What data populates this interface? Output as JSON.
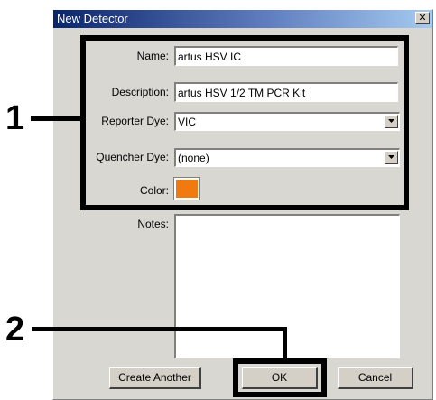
{
  "window": {
    "title": "New Detector",
    "close_glyph": "✕"
  },
  "form": {
    "name_label": "Name:",
    "name_value": "artus HSV IC",
    "description_label": "Description:",
    "description_value": "artus HSV 1/2 TM PCR Kit",
    "reporter_dye_label": "Reporter Dye:",
    "reporter_dye_value": "VIC",
    "quencher_dye_label": "Quencher Dye:",
    "quencher_dye_value": "(none)",
    "color_label": "Color:",
    "color_value": "#f07a10",
    "notes_label": "Notes:",
    "notes_value": ""
  },
  "buttons": {
    "create_another": "Create Another",
    "ok": "OK",
    "cancel": "Cancel"
  },
  "annotations": {
    "callout_1": "1",
    "callout_2": "2"
  },
  "icons": {
    "dropdown": "chevron-down-icon",
    "close": "close-icon"
  }
}
